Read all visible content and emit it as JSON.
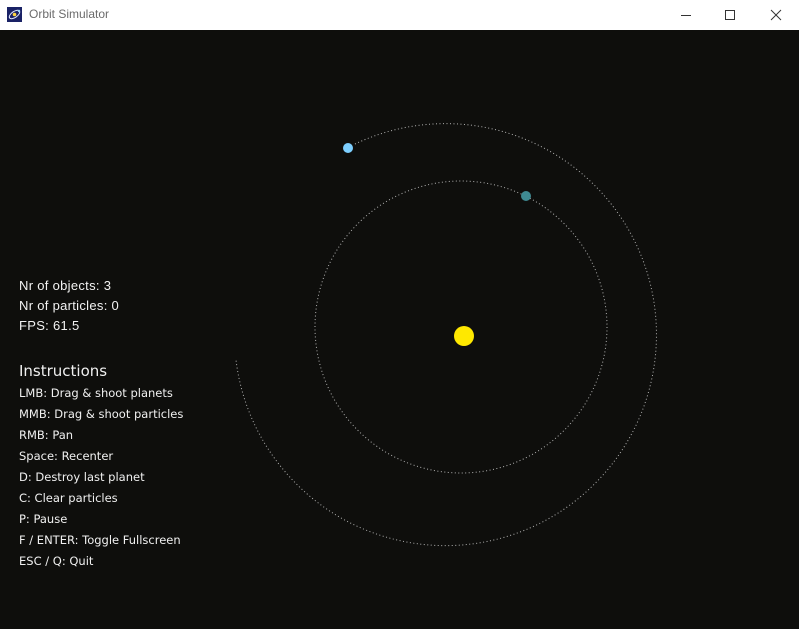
{
  "window": {
    "title": "Orbit Simulator",
    "controls": [
      "minimize-icon",
      "maximize-icon",
      "close-icon"
    ]
  },
  "stats": {
    "objects": "Nr of objects: 3",
    "particles": "Nr of particles: 0",
    "fps": "FPS: 61.5"
  },
  "instructions": {
    "title": "Instructions",
    "items": [
      "LMB: Drag & shoot planets",
      "MMB: Drag & shoot particles",
      "RMB: Pan",
      "Space: Recenter",
      "D: Destroy last planet",
      "C: Clear particles",
      "P: Pause",
      "F / ENTER: Toggle Fullscreen",
      "ESC / Q: Quit"
    ]
  },
  "colors": {
    "background": "#0e0e0c",
    "sun": "#ffe800",
    "planet_outer": "#7dcfff",
    "planet_inner": "#3f8a92",
    "orbit_trail": "#d8d8d8"
  }
}
